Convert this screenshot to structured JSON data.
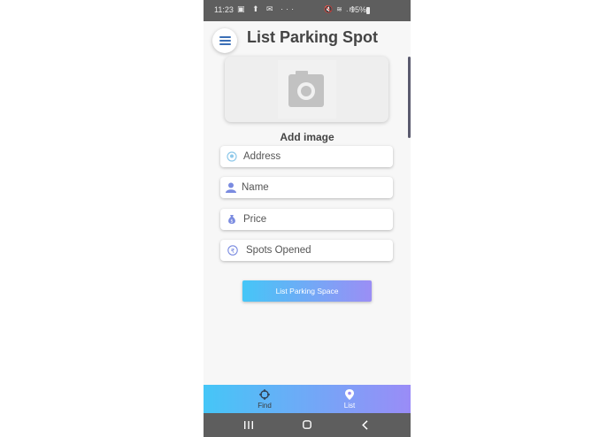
{
  "status_bar": {
    "time": "11:23",
    "left_icons": "▣ ⬆ ✉ ···",
    "right_icons": "🔇 ≋ .ıl",
    "battery": "95%"
  },
  "header": {
    "title": "List Parking Spot",
    "menu_icon": "hamburger-menu-icon"
  },
  "image_upload": {
    "label": "Add image",
    "icon": "camera-icon"
  },
  "form": {
    "fields": [
      {
        "placeholder": "Address",
        "icon": "location-icon"
      },
      {
        "placeholder": "Name",
        "icon": "person-icon"
      },
      {
        "placeholder": "Price",
        "icon": "money-bag-icon"
      },
      {
        "placeholder": "Spots Opened",
        "icon": "rupee-circle-icon"
      }
    ],
    "submit_label": "List Parking Space"
  },
  "bottom_nav": {
    "items": [
      {
        "label": "Find",
        "icon": "crosshair-icon",
        "active": false
      },
      {
        "label": "List",
        "icon": "map-pin-icon",
        "active": true
      }
    ]
  },
  "system_nav": {
    "recents": "recents-icon",
    "home": "home-icon",
    "back": "back-icon"
  },
  "colors": {
    "gradient_start": "#45c6f7",
    "gradient_end": "#9b8ef5",
    "title_text": "#444444",
    "icon_blue": "#7a8be0"
  }
}
